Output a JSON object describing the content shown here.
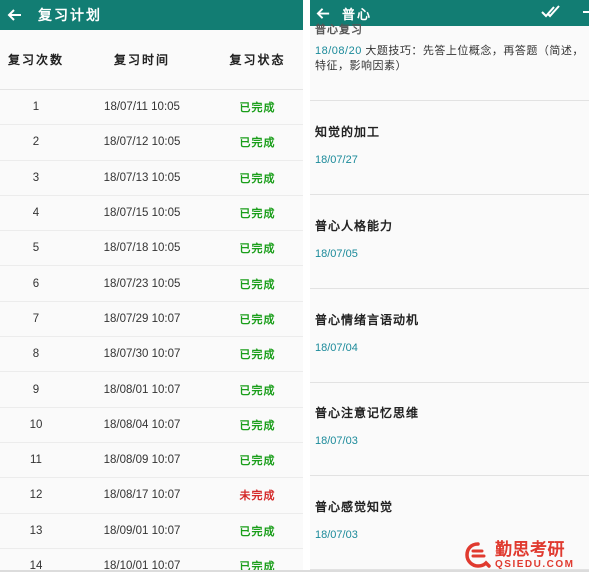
{
  "left": {
    "title": "复习计划",
    "columns": [
      "复习次数",
      "复习时间",
      "复习状态"
    ],
    "rows": [
      {
        "n": "1",
        "time": "18/07/11 10:05",
        "status": "已完成",
        "done": true
      },
      {
        "n": "2",
        "time": "18/07/12 10:05",
        "status": "已完成",
        "done": true
      },
      {
        "n": "3",
        "time": "18/07/13 10:05",
        "status": "已完成",
        "done": true
      },
      {
        "n": "4",
        "time": "18/07/15 10:05",
        "status": "已完成",
        "done": true
      },
      {
        "n": "5",
        "time": "18/07/18 10:05",
        "status": "已完成",
        "done": true
      },
      {
        "n": "6",
        "time": "18/07/23 10:05",
        "status": "已完成",
        "done": true
      },
      {
        "n": "7",
        "time": "18/07/29 10:07",
        "status": "已完成",
        "done": true
      },
      {
        "n": "8",
        "time": "18/07/30 10:07",
        "status": "已完成",
        "done": true
      },
      {
        "n": "9",
        "time": "18/08/01 10:07",
        "status": "已完成",
        "done": true
      },
      {
        "n": "10",
        "time": "18/08/04 10:07",
        "status": "已完成",
        "done": true
      },
      {
        "n": "11",
        "time": "18/08/09 10:07",
        "status": "已完成",
        "done": true
      },
      {
        "n": "12",
        "time": "18/08/17 10:07",
        "status": "未完成",
        "done": false
      },
      {
        "n": "13",
        "time": "18/09/01 10:07",
        "status": "已完成",
        "done": true
      },
      {
        "n": "14",
        "time": "18/10/01 10:07",
        "status": "已完成",
        "done": true
      }
    ]
  },
  "right": {
    "title": "普心",
    "first_note": {
      "title": "普心复习",
      "date": "18/08/20",
      "body": "大题技巧：先答上位概念，再答题（简述，特征，影响因素）"
    },
    "notes": [
      {
        "title": "知觉的加工",
        "date": "18/07/27"
      },
      {
        "title": "普心人格能力",
        "date": "18/07/05"
      },
      {
        "title": "普心情绪言语动机",
        "date": "18/07/04"
      },
      {
        "title": "普心注意记忆思维",
        "date": "18/07/03"
      },
      {
        "title": "普心感觉知觉",
        "date": "18/07/03"
      }
    ]
  },
  "watermark": {
    "cn": "勤思考研",
    "en": "QSIEDU.COM"
  },
  "colors": {
    "appbar": "#127d73",
    "done": "#1a9e1a",
    "undone": "#d42a2a",
    "date": "#1b8a9a",
    "watermark": "#e03a2f"
  },
  "icons": [
    "back-arrow-icon",
    "double-check-icon",
    "more-icon",
    "watermark-logo-icon"
  ]
}
